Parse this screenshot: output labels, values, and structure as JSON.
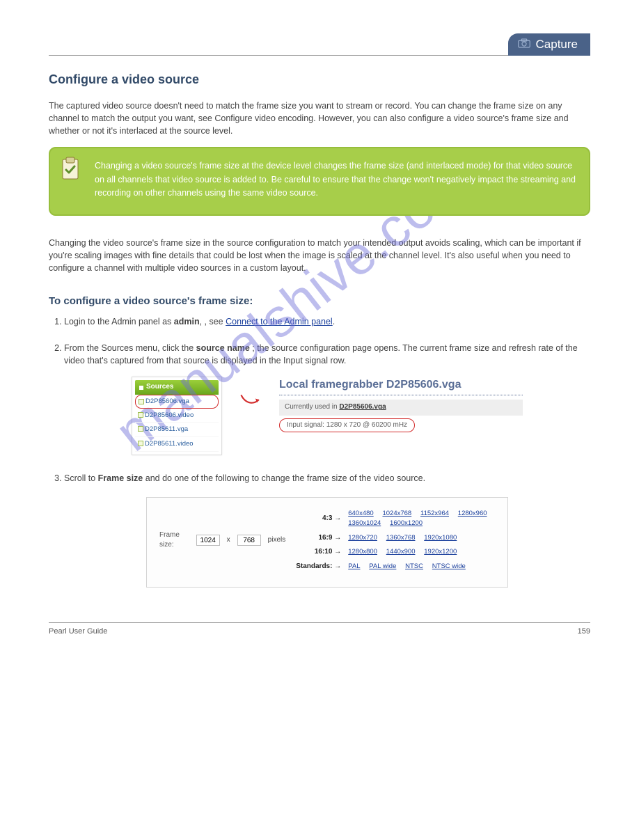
{
  "watermark": "manualshive.com",
  "header": {
    "badge_label": "Capture"
  },
  "section": {
    "title": "Configure a video source",
    "intro": "The captured video source doesn't need to match the frame size you want to stream or record. You can change the frame size on any channel to match the output you want, see Configure video encoding. However, you can also configure a video source's frame size and whether or not it's interlaced at the source level.",
    "note": "Changing a video source's frame size at the device level changes the frame size (and interlaced mode) for that video source on all channels that video source is added to. Be careful to ensure that the change won't negatively impact the streaming and recording on other channels using the same video source.",
    "para2": "Changing the video source's frame size in the source configuration to match your intended output avoids scaling, which can be important if you're scaling images with fine details that could be lost when the image is scaled at the channel level. It's also useful when you need to configure a channel with multiple video sources in a custom layout."
  },
  "procedure": {
    "heading": "To configure a video source's frame size:",
    "steps": {
      "s1_lead": "Login to the Admin panel as",
      "s1_role": "admin",
      "s1_tail": ", see",
      "s1_link": "Connect to the Admin panel",
      "s2_lead": "From the Sources menu, click the ",
      "s2_bold": "source name",
      "s2_tail": "; the source configuration page opens. The current frame size and refresh rate of the video that's captured from that source is displayed in the Input signal row.",
      "s3_lead": "Scroll to",
      "s3_bold": "Frame size",
      "s3_tail": "and do one of the following to change the frame size of the video source."
    }
  },
  "fig1": {
    "sources_header": "Sources",
    "items": [
      "D2P85606.vga",
      "D2P85606.video",
      "D2P85611.vga",
      "D2P85611.video"
    ],
    "fg_title": "Local framegrabber D2P85606.vga",
    "used_label": "Currently used in ",
    "used_value": "D2P85606.vga",
    "signal": "Input signal: 1280 x 720 @ 60200 mHz"
  },
  "fig2": {
    "label": "Frame size:",
    "dim_w": "1024",
    "dim_h": "768",
    "px": "pixels",
    "rows": [
      {
        "ratio": "4:3 →",
        "links": [
          "640x480",
          "1024x768",
          "1152x964",
          "1280x960",
          "1360x1024",
          "1600x1200"
        ]
      },
      {
        "ratio": "16:9 →",
        "links": [
          "1280x720",
          "1360x768",
          "1920x1080"
        ]
      },
      {
        "ratio": "16:10 →",
        "links": [
          "1280x800",
          "1440x900",
          "1920x1200"
        ]
      },
      {
        "ratio": "Standards: →",
        "links": [
          "PAL",
          "PAL wide",
          "NTSC",
          "NTSC wide"
        ]
      }
    ]
  },
  "footer": {
    "left": "Pearl User Guide",
    "right": "159"
  }
}
